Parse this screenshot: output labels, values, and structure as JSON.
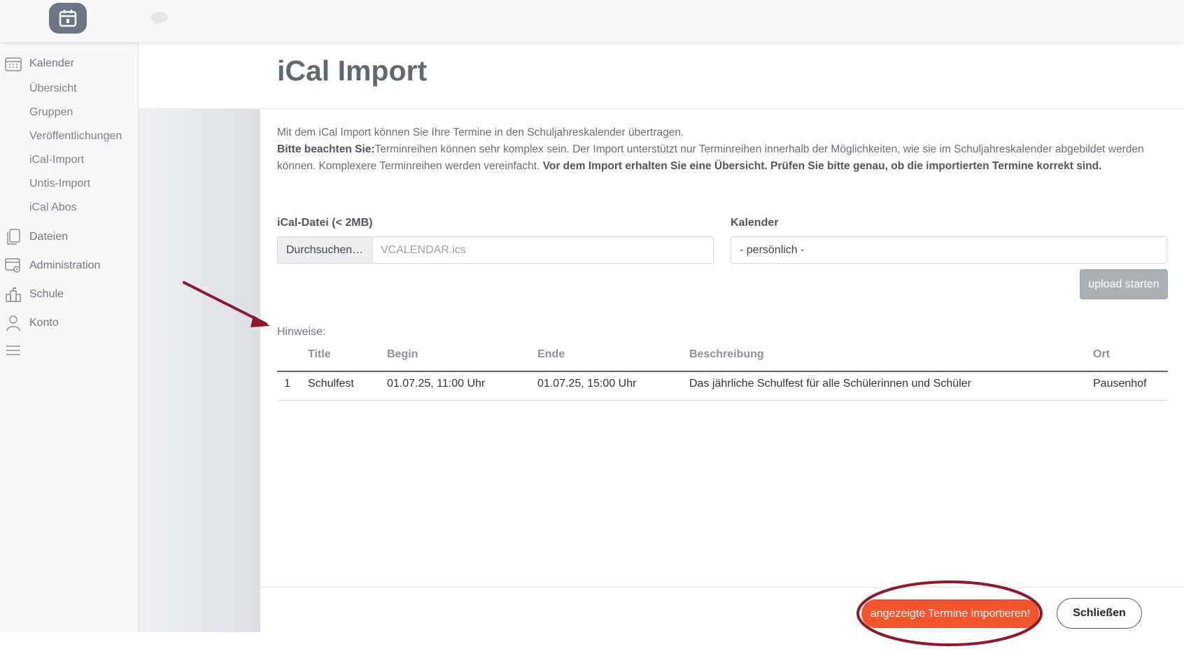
{
  "sidebar": {
    "calendar_label": "Kalender",
    "calendar_items": [
      "Übersicht",
      "Gruppen",
      "Veröffentlichungen",
      "iCal-Import",
      "Untis-Import",
      "iCal Abos"
    ],
    "files_label": "Dateien",
    "admin_label": "Administration",
    "school_label": "Schule",
    "account_label": "Konto"
  },
  "page": {
    "title": "iCal Import",
    "intro_line1": "Mit dem iCal Import können Sie Ihre Termine in den Schuljahreskalender übertragen.",
    "note_label": "Bitte beachten Sie:",
    "note_text": "Terminreihen können sehr komplex sein. Der Import unterstützt nur Terminreihen innerhalb der Möglichkeiten, wie sie im Schuljahreskalender abgebildet werden können. Komplexere Terminreihen werden vereinfacht.",
    "note_bold": "Vor dem Import erhalten Sie eine Übersicht. Prüfen Sie bitte genau, ob die importierten Termine korrekt sind."
  },
  "form": {
    "file_label": "iCal-Datei (< 2MB)",
    "browse_label": "Durchsuchen…",
    "file_value": "VCALENDAR.ics",
    "calendar_label": "Kalender",
    "calendar_value": "- persönlich -",
    "upload_label": "upload starten"
  },
  "table": {
    "hint_label": "Hinweise:",
    "headers": [
      "Title",
      "Begin",
      "Ende",
      "Beschreibung",
      "Ort"
    ],
    "rows": [
      {
        "num": "1",
        "title": "Schulfest",
        "begin": "01.07.25, 11:00 Uhr",
        "end": "01.07.25, 15:00 Uhr",
        "description": "Das jährliche Schulfest für alle Schülerinnen und Schüler",
        "location": "Pausenhof"
      }
    ]
  },
  "footer": {
    "import_label": "angezeigte Termine importieren!",
    "close_label": "Schließen"
  },
  "colors": {
    "accent": "#f2552c",
    "annotation": "#8b1a2b"
  }
}
